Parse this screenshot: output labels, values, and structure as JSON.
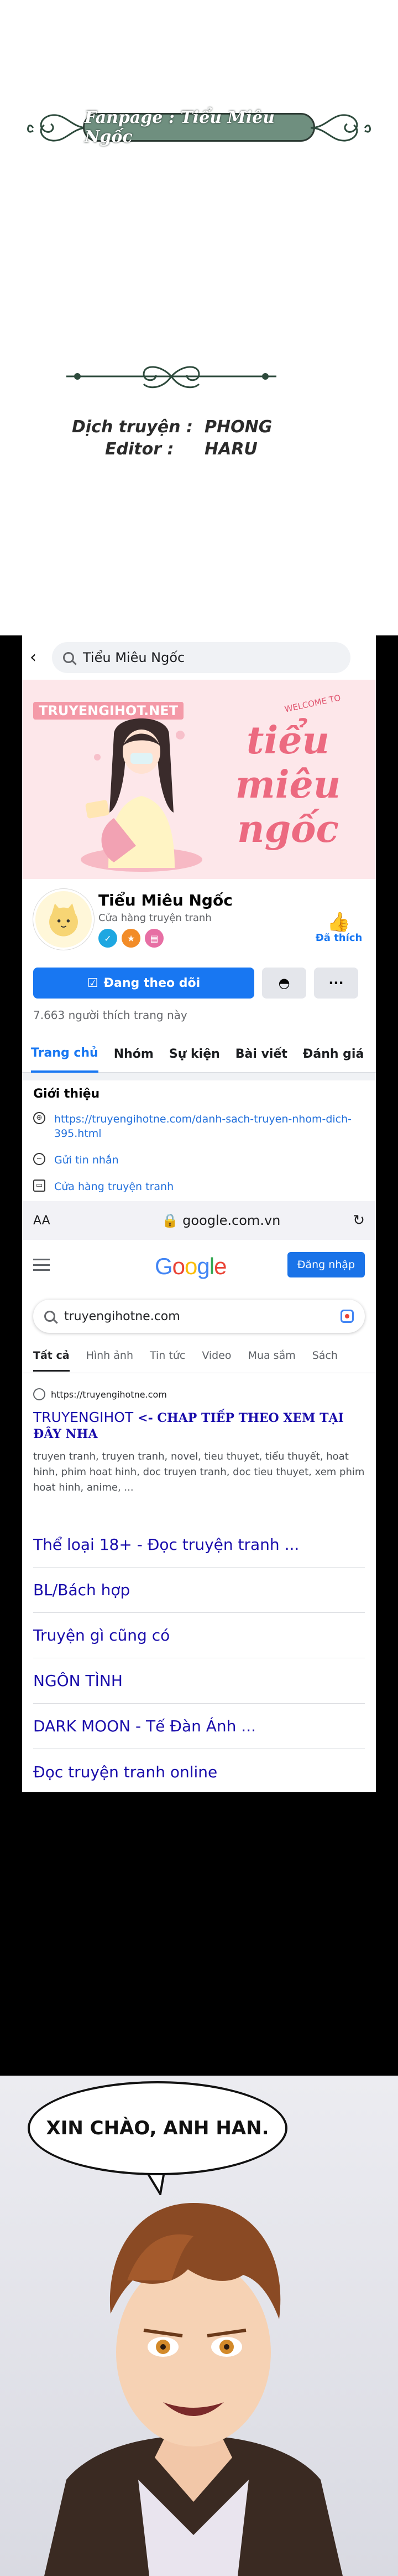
{
  "credits": {
    "fanpage": "Fanpage : Tiểu Miêu Ngốc",
    "translator_key": "Dịch truyện :",
    "translator_val": "PHONG",
    "editor_key": "Editor :",
    "editor_val": "HARU"
  },
  "facebook": {
    "search_text": "Tiểu Miêu Ngốc",
    "cover_site": "TRUYENGIHOT.NET",
    "cover_welcome": "WELCOME TO",
    "cover_script": "tiểu miêu ngốc",
    "page_name": "Tiểu Miêu Ngốc",
    "page_category": "Cửa hàng truyện tranh",
    "liked_label": "Đã thích",
    "follow_label": "Đang theo dõi",
    "more_label": "···",
    "likes_count": "7.663 người thích trang này",
    "tabs": [
      "Trang chủ",
      "Nhóm",
      "Sự kiện",
      "Bài viết",
      "Đánh giá"
    ],
    "intro_title": "Giới thiệu",
    "intro_items": [
      "https://truyengihotne.com/danh-sach-truyen-nhom-dich-395.html",
      "Gửi tin nhắn",
      "Cửa hàng truyện tranh"
    ],
    "colors": {
      "brand": "#1877f2"
    }
  },
  "safari": {
    "aa": "AA",
    "url": "google.com.vn"
  },
  "google": {
    "logo": "Google",
    "signin": "Đăng nhập",
    "query": "truyengihotne.com",
    "tabs": [
      "Tất cả",
      "Hình ảnh",
      "Tin tức",
      "Video",
      "Mua sắm",
      "Sách"
    ],
    "result_url": "https://truyengihotne.com",
    "result_title_a": "TRUYENGIHOT",
    "result_title_b": "<- CHAP TIẾP THEO XEM TẠI ĐÂY NHA",
    "result_snippet": "truyen tranh, truyen tranh, novel, tieu thuyet, tiểu thuyết, hoat hinh, phim hoat hinh, doc truyen tranh, doc tieu thuyet, xem phim hoat hinh, anime, ...",
    "sitelinks": [
      "Thể loại 18+ - Đọc truyện tranh ...",
      "BL/Bách hợp",
      "Truyện gì cũng có",
      "NGÔN TÌNH",
      "DARK MOON - Tế Đàn Ánh ...",
      "Đọc truyện tranh online"
    ]
  },
  "comic": {
    "speech": "XIN CHÀO, ANH HAN."
  }
}
